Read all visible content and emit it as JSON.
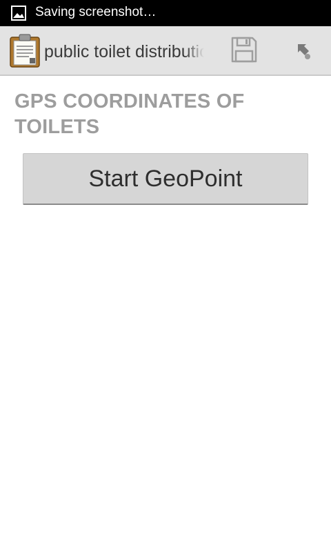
{
  "status_bar": {
    "notification_icon": "image-icon",
    "text": "Saving screenshot…",
    "background_color": "#000000"
  },
  "action_bar": {
    "app_icon": "clipboard-icon",
    "title": "public toilet distribution",
    "save_icon": "floppy-disk-icon",
    "export_icon": "arrow-down-right-icon",
    "background_color": "#e3e3e3"
  },
  "form": {
    "question_label": "GPS COORDINATES OF TOILETS",
    "label_color": "#9d9d9d",
    "start_geopoint_label": "Start GeoPoint"
  }
}
